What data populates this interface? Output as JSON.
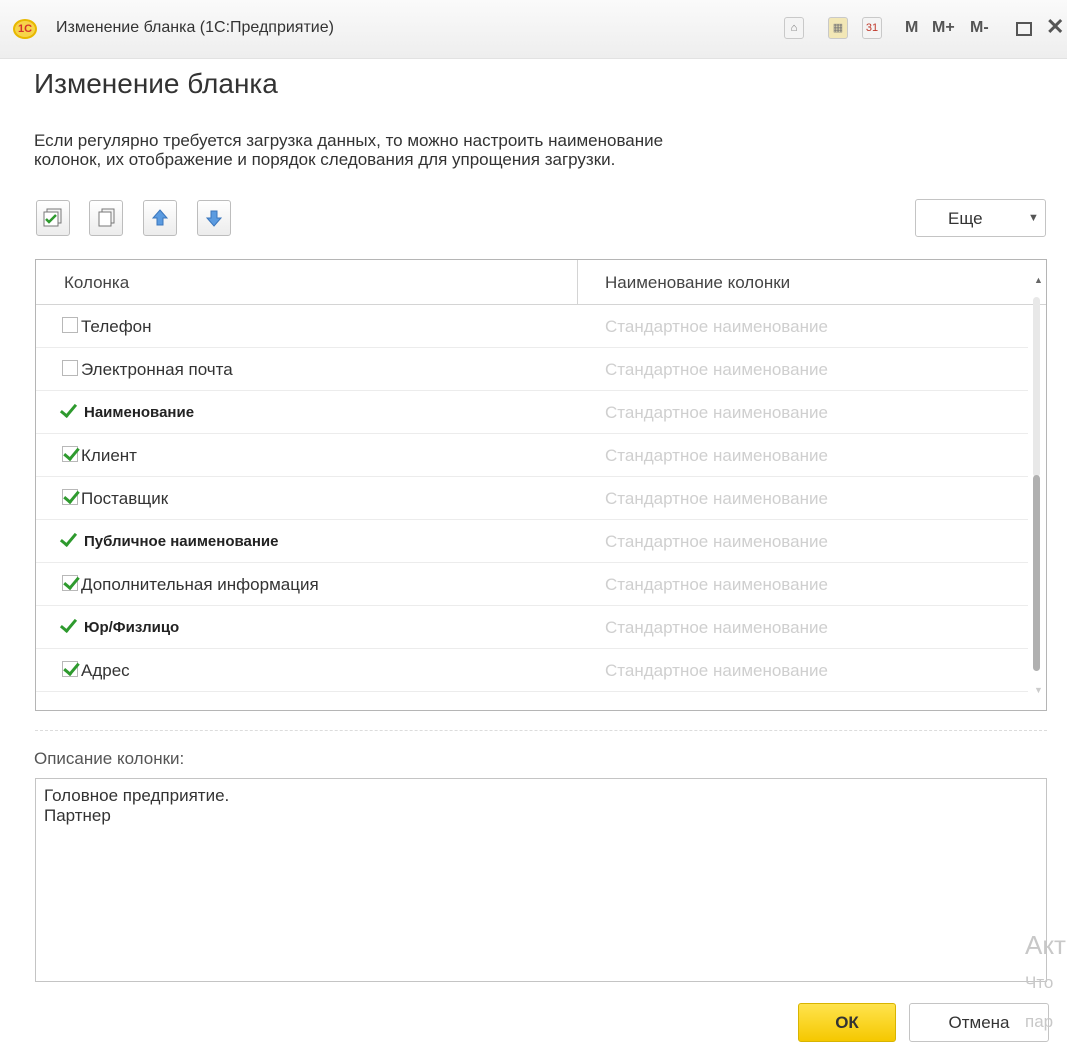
{
  "window": {
    "title": "Изменение бланка (1С:Предприятие)",
    "logo_text": "1С"
  },
  "titlebar_tools": {
    "calendar_date": "31",
    "m": "M",
    "m_plus": "M+",
    "m_minus": "M-"
  },
  "form": {
    "title": "Изменение бланка",
    "description_line1": "Если регулярно требуется загрузка данных, то можно настроить наименование",
    "description_line2": "колонок, их отображение и порядок следования для упрощения загрузки."
  },
  "toolbar": {
    "more_label": "Еще"
  },
  "table": {
    "headers": [
      "Колонка",
      "Наименование колонки"
    ],
    "rows": [
      {
        "name": "Телефон",
        "state": "unchecked",
        "title": "Стандартное наименование"
      },
      {
        "name": "Электронная почта",
        "state": "unchecked",
        "title": "Стандартное наименование"
      },
      {
        "name": "Наименование",
        "state": "required",
        "title": "Стандартное наименование"
      },
      {
        "name": "Клиент",
        "state": "checked",
        "title": "Стандартное наименование"
      },
      {
        "name": "Поставщик",
        "state": "checked",
        "title": "Стандартное наименование"
      },
      {
        "name": "Публичное наименование",
        "state": "required",
        "title": "Стандартное наименование"
      },
      {
        "name": "Дополнительная информация",
        "state": "checked",
        "title": "Стандартное наименование"
      },
      {
        "name": "Юр/Физлицо",
        "state": "required",
        "title": "Стандартное наименование"
      },
      {
        "name": "Адрес",
        "state": "checked",
        "title": "Стандартное наименование"
      }
    ]
  },
  "column_description": {
    "label": "Описание колонки:",
    "line1": "Головное предприятие.",
    "line2": "Партнер"
  },
  "buttons": {
    "ok": "ОК",
    "cancel": "Отмена"
  },
  "watermark": {
    "line1": "Акт",
    "line2": "Что",
    "line3": "пар"
  },
  "colors": {
    "accent_yellow": "#f5c800",
    "check_green": "#2e9a2e",
    "placeholder_gray": "#cfcfcf"
  }
}
